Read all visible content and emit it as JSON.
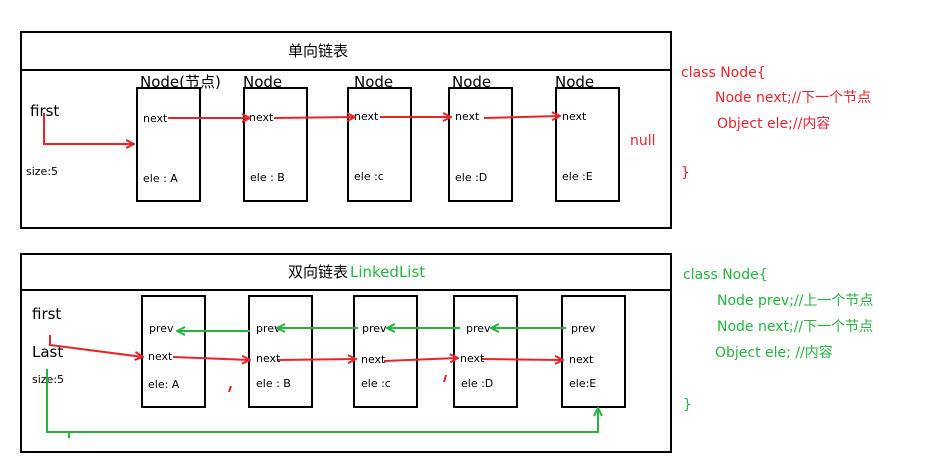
{
  "colors": {
    "red": "#e8242b",
    "green": "#27b33f",
    "black": "#000000"
  },
  "singly": {
    "title": "单向链表",
    "first_label": "first",
    "size_label": "size:5",
    "null_label": "null",
    "node_captions": [
      "Node(节点)",
      "Node",
      "Node",
      "Node",
      "Node"
    ],
    "nodes": [
      {
        "next": "next",
        "ele": "ele : A"
      },
      {
        "next": "next",
        "ele": "ele : B"
      },
      {
        "next": "next",
        "ele": "ele :c"
      },
      {
        "next": "next",
        "ele": "ele :D"
      },
      {
        "next": "next",
        "ele": "ele :E"
      }
    ],
    "code": [
      "class Node{",
      "Node next;//下一个节点",
      "Object ele;//内容",
      "}"
    ]
  },
  "doubly": {
    "title": "双向链表",
    "title_suffix": "LinkedList",
    "first_label": "first",
    "last_label": "Last",
    "size_label": "size:5",
    "nodes": [
      {
        "prev": "prev",
        "next": "next",
        "ele": "ele: A"
      },
      {
        "prev": "prev",
        "next": "next",
        "ele": "ele : B"
      },
      {
        "prev": "prev",
        "next": "next",
        "ele": "ele :c"
      },
      {
        "prev": "prev",
        "next": "next",
        "ele": "ele :D"
      },
      {
        "prev": "prev",
        "next": "next",
        "ele": "ele:E"
      }
    ],
    "code": [
      "class Node{",
      "Node prev;//上一个节点",
      "Node next;//下一个节点",
      "Object ele; //内容",
      "}"
    ]
  }
}
